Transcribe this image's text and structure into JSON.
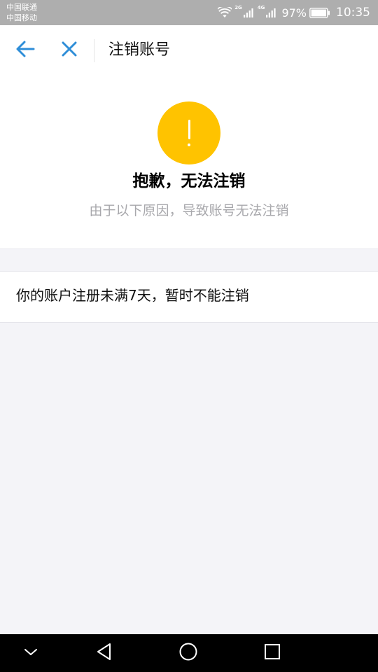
{
  "status_bar": {
    "carrier_1": "中国联通",
    "carrier_2": "中国移动",
    "network_1": "2G",
    "network_2": "4G",
    "battery_percent": "97%",
    "time": "10:35"
  },
  "header": {
    "title": "注销账号",
    "back_icon": "arrow-left-icon",
    "close_icon": "close-icon"
  },
  "notice": {
    "icon": "exclamation-icon",
    "title": "抱歉，无法注销",
    "subtitle": "由于以下原因，导致账号无法注销"
  },
  "reasons": [
    {
      "text": "你的账户注册未满7天，暂时不能注销"
    }
  ],
  "colors": {
    "accent": "#2f8ed8",
    "warning": "#ffc300",
    "status_bar": "#aeaeae",
    "page_background": "#f4f4f8"
  }
}
